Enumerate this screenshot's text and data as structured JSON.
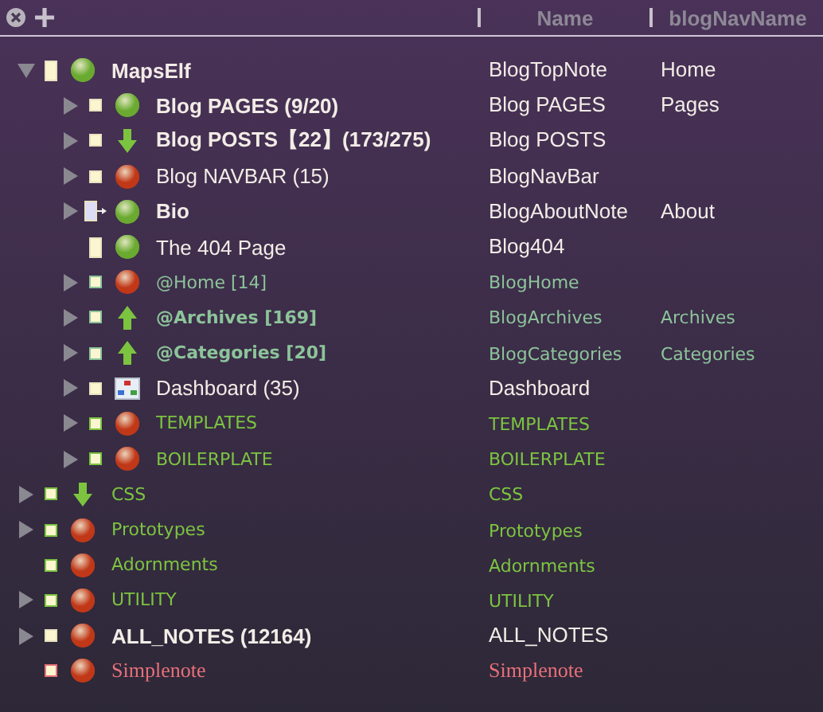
{
  "header": {
    "columns": [
      "Name",
      "blogNavName"
    ]
  },
  "rows": [
    {
      "title": "MapsElf",
      "bold": true,
      "color": "#f2ece6",
      "typeface": {
        "kind": "sans"
      },
      "note": {
        "kind": "page"
      },
      "status": {
        "kind": "ball",
        "color": "#6aaa30"
      },
      "expanded": true,
      "name": "BlogTopNote",
      "nav": "Home",
      "children": [
        {
          "title": "Blog PAGES (9/20)",
          "bold": true,
          "color": "#f2ece6",
          "typeface": {
            "kind": "sans"
          },
          "note": {
            "kind": "square"
          },
          "status": {
            "kind": "ball",
            "color": "#6aaa30"
          },
          "expanded": false,
          "name": "Blog PAGES",
          "nav": "Pages"
        },
        {
          "title": "Blog POSTS【22】(173/275)",
          "bold": true,
          "color": "#f2ece6",
          "typeface": {
            "kind": "sans"
          },
          "note": {
            "kind": "square"
          },
          "status": {
            "kind": "down"
          },
          "expanded": false,
          "name": "Blog POSTS"
        },
        {
          "title": "Blog NAVBAR (15)",
          "bold": false,
          "color": "#f2ece6",
          "typeface": {
            "kind": "sans"
          },
          "note": {
            "kind": "square"
          },
          "status": {
            "kind": "ball",
            "color": "#c03818"
          },
          "expanded": false,
          "name": "BlogNavBar"
        },
        {
          "title": "Bio",
          "bold": true,
          "color": "#f2ece6",
          "typeface": {
            "kind": "sans"
          },
          "note": {
            "kind": "link"
          },
          "status": {
            "kind": "ball",
            "color": "#6aaa30"
          },
          "expanded": false,
          "name": "BlogAboutNote",
          "nav": "About"
        },
        {
          "title": "The 404 Page",
          "bold": false,
          "color": "#f2ece6",
          "typeface": {
            "kind": "sans"
          },
          "note": {
            "kind": "page"
          },
          "status": {
            "kind": "ball",
            "color": "#6aaa30"
          },
          "name": "Blog404"
        },
        {
          "title": "@Home [14]",
          "bold": false,
          "color": "#8cc49a",
          "typeface": {
            "kind": "geometric"
          },
          "note": {
            "kind": "square"
          },
          "status": {
            "kind": "ball",
            "color": "#c03818"
          },
          "expanded": false,
          "name": "BlogHome"
        },
        {
          "title": "@Archives [169]",
          "bold": true,
          "color": "#8cc49a",
          "typeface": {
            "kind": "geometric"
          },
          "note": {
            "kind": "square"
          },
          "status": {
            "kind": "up"
          },
          "expanded": false,
          "name": "BlogArchives",
          "nav": "Archives"
        },
        {
          "title": "@Categories [20]",
          "bold": true,
          "color": "#8cc49a",
          "typeface": {
            "kind": "geometric"
          },
          "note": {
            "kind": "square"
          },
          "status": {
            "kind": "up"
          },
          "expanded": false,
          "name": "BlogCategories",
          "nav": "Categories"
        },
        {
          "title": "Dashboard (35)",
          "bold": false,
          "color": "#f2ece6",
          "typeface": {
            "kind": "sans"
          },
          "note": {
            "kind": "square"
          },
          "status": {
            "kind": "diagram"
          },
          "expanded": false,
          "name": "Dashboard"
        },
        {
          "title": "TEMPLATES",
          "bold": false,
          "color": "#7cc440",
          "typeface": {
            "kind": "geometric"
          },
          "note": {
            "kind": "square"
          },
          "status": {
            "kind": "ball",
            "color": "#c03818"
          },
          "expanded": false,
          "name": "TEMPLATES"
        },
        {
          "title": "BOILERPLATE",
          "bold": false,
          "color": "#7cc440",
          "typeface": {
            "kind": "geometric"
          },
          "note": {
            "kind": "square"
          },
          "status": {
            "kind": "ball",
            "color": "#c03818"
          },
          "expanded": false,
          "name": "BOILERPLATE"
        }
      ]
    },
    {
      "title": "CSS",
      "bold": false,
      "color": "#7cc440",
      "typeface": {
        "kind": "geometric"
      },
      "note": {
        "kind": "square"
      },
      "status": {
        "kind": "down"
      },
      "expanded": false,
      "name": "CSS"
    },
    {
      "title": "Prototypes",
      "bold": false,
      "color": "#7cc440",
      "typeface": {
        "kind": "geometric"
      },
      "note": {
        "kind": "square"
      },
      "status": {
        "kind": "ball",
        "color": "#c03818"
      },
      "expanded": false,
      "name": "Prototypes"
    },
    {
      "title": "Adornments",
      "bold": false,
      "color": "#7cc440",
      "typeface": {
        "kind": "geometric"
      },
      "note": {
        "kind": "square"
      },
      "status": {
        "kind": "ball",
        "color": "#c03818"
      },
      "name": "Adornments"
    },
    {
      "title": "UTILITY",
      "bold": false,
      "color": "#7cc440",
      "typeface": {
        "kind": "geometric"
      },
      "note": {
        "kind": "square"
      },
      "status": {
        "kind": "ball",
        "color": "#c03818"
      },
      "expanded": false,
      "name": "UTILITY"
    },
    {
      "title": "ALL_NOTES (12164)",
      "bold": true,
      "color": "#f2ece6",
      "typeface": {
        "kind": "sans"
      },
      "note": {
        "kind": "square"
      },
      "status": {
        "kind": "ball",
        "color": "#c03818"
      },
      "expanded": false,
      "name": "ALL_NOTES"
    },
    {
      "title": "Simplenote",
      "bold": false,
      "color": "#e8707a",
      "typeface": {
        "kind": "serif"
      },
      "note": {
        "kind": "square"
      },
      "status": {
        "kind": "ball",
        "color": "#c03818"
      },
      "name": "Simplenote"
    }
  ]
}
